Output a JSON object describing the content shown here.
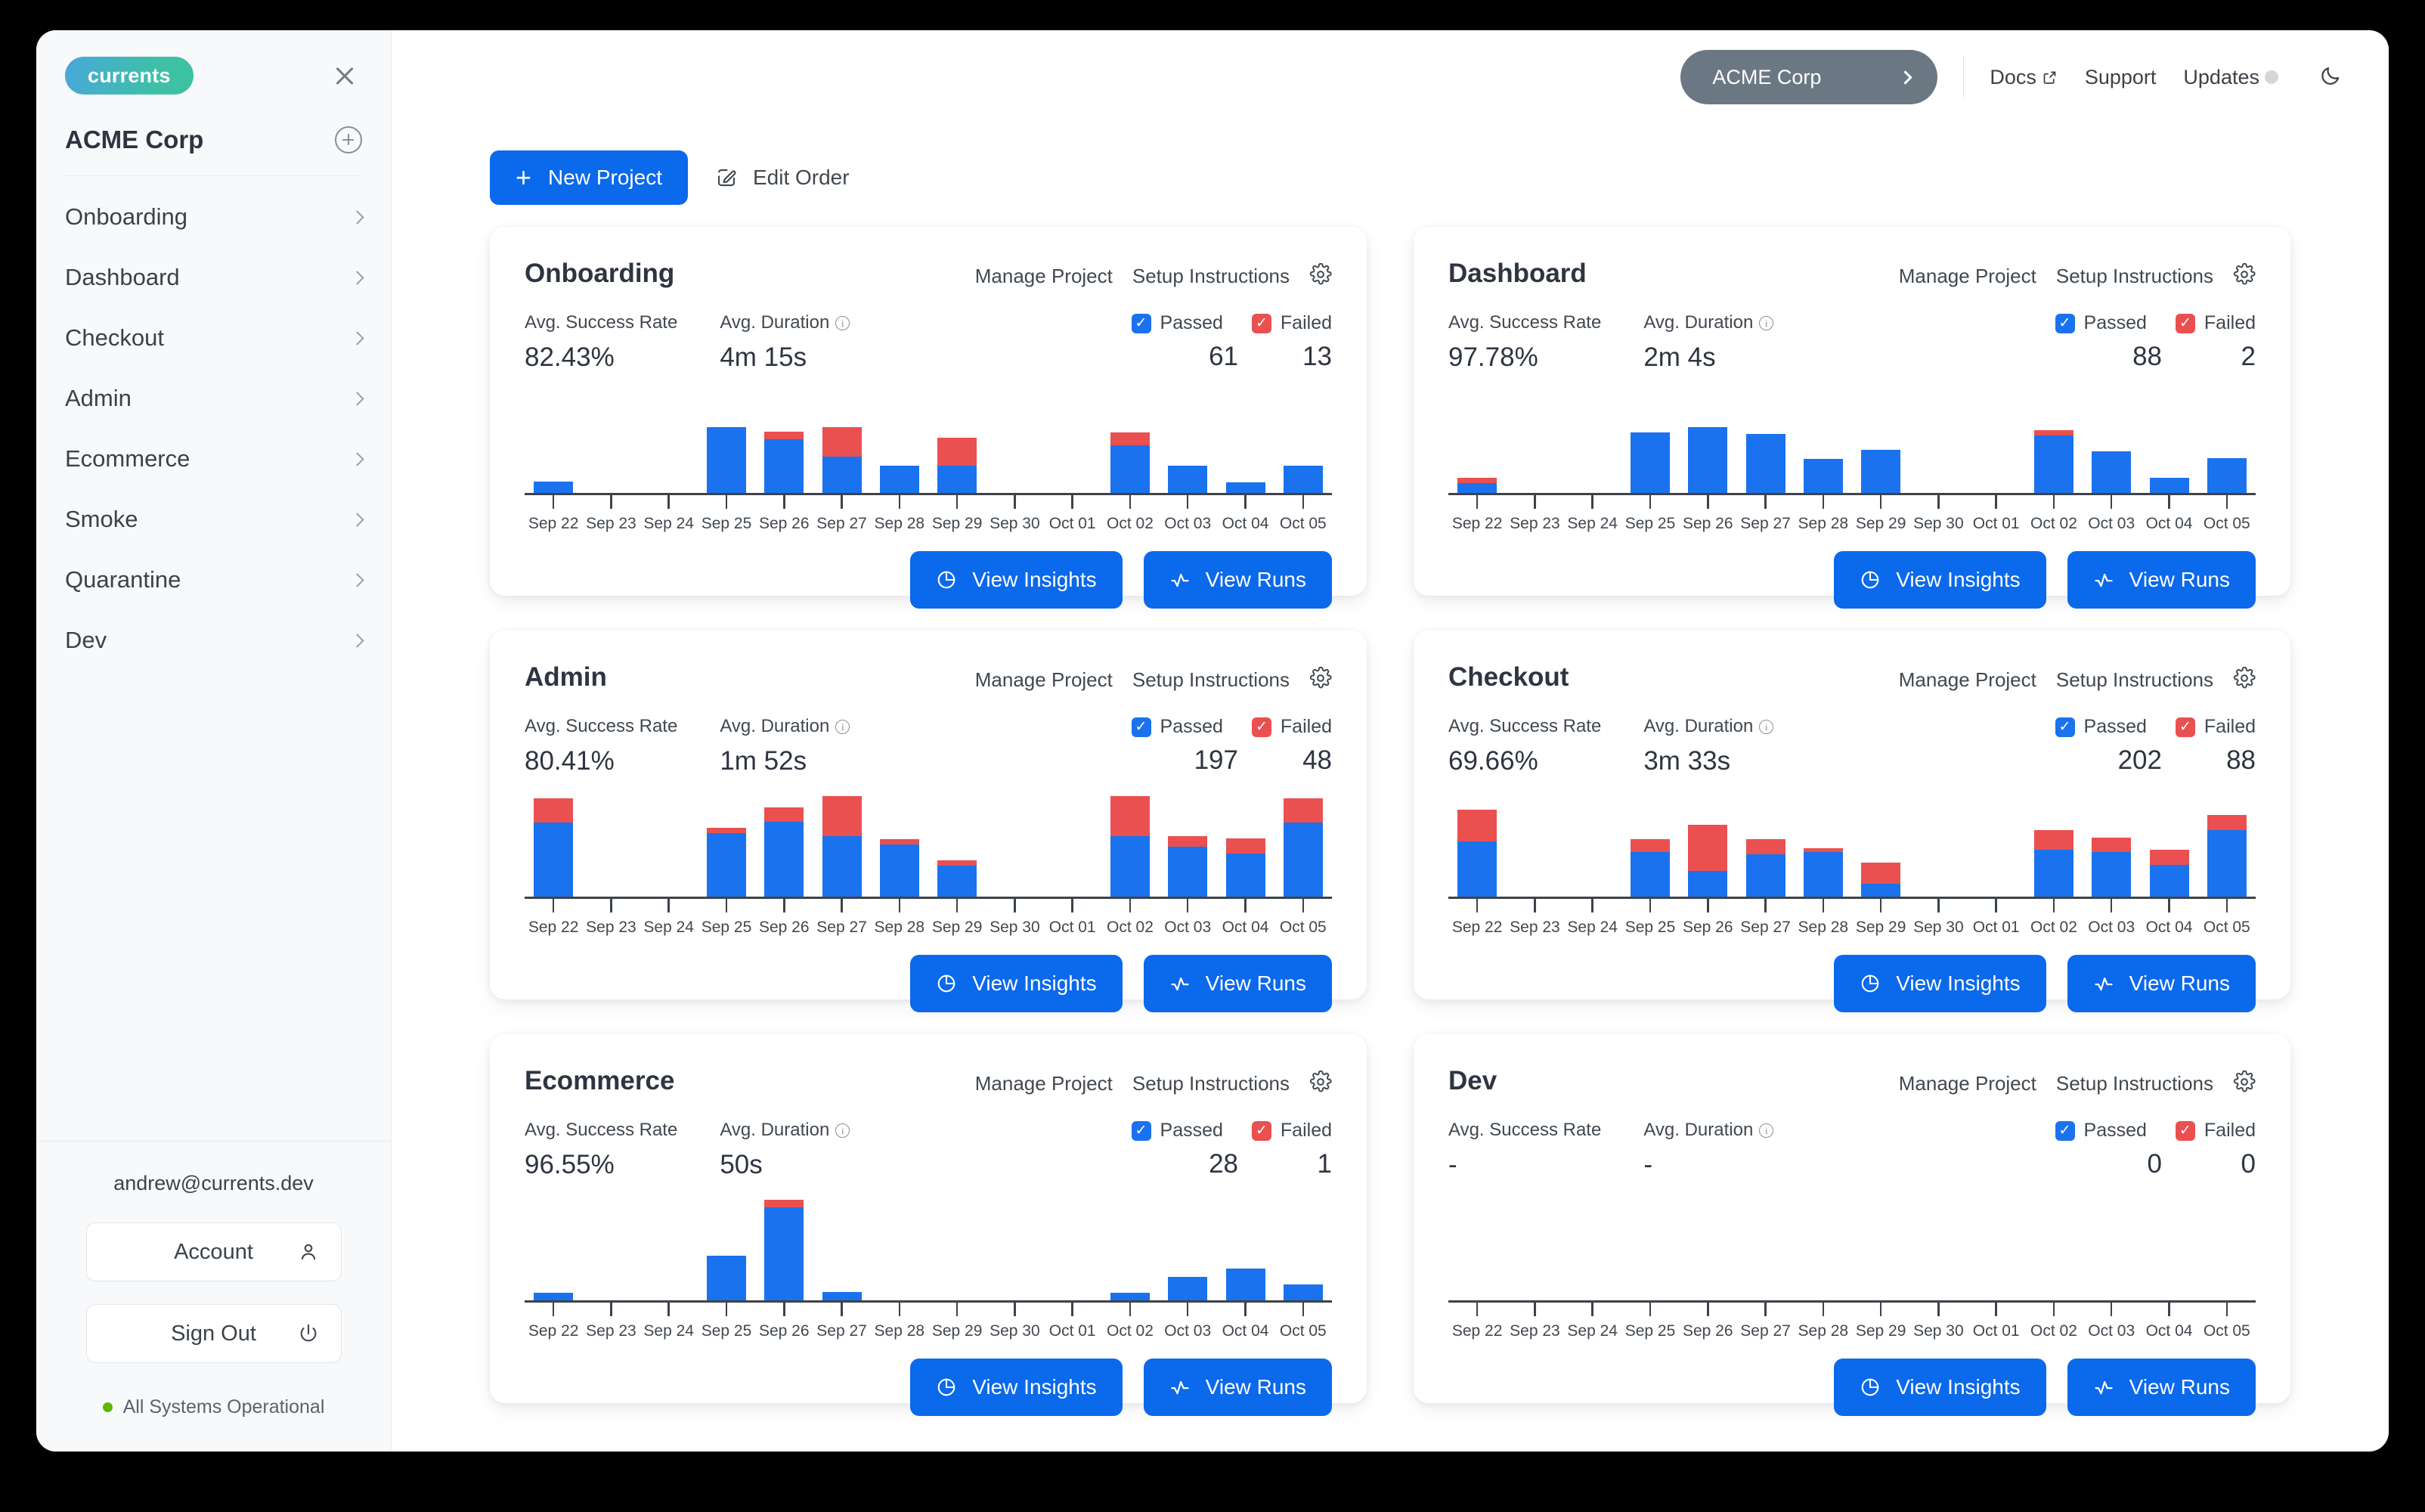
{
  "sidebar": {
    "logo": "currents",
    "close_icon": "close-icon",
    "org_name": "ACME Corp",
    "add_icon": "plus-circle-icon",
    "items": [
      {
        "label": "Onboarding"
      },
      {
        "label": "Dashboard"
      },
      {
        "label": "Checkout"
      },
      {
        "label": "Admin"
      },
      {
        "label": "Ecommerce"
      },
      {
        "label": "Smoke"
      },
      {
        "label": "Quarantine"
      },
      {
        "label": "Dev"
      }
    ],
    "email": "andrew@currents.dev",
    "account_label": "Account",
    "signout_label": "Sign Out",
    "status_text": "All Systems Operational",
    "status_color": "#5cb800"
  },
  "topbar": {
    "org_button": "ACME Corp",
    "docs": "Docs",
    "support": "Support",
    "updates": "Updates",
    "theme_icon": "moon-icon"
  },
  "toolbar": {
    "new_project": "New Project",
    "edit_order": "Edit Order"
  },
  "card_labels": {
    "manage_project": "Manage Project",
    "setup_instructions": "Setup Instructions",
    "avg_success_rate": "Avg. Success Rate",
    "avg_duration": "Avg. Duration",
    "passed": "Passed",
    "failed": "Failed",
    "view_insights": "View Insights",
    "view_runs": "View Runs"
  },
  "colors": {
    "passed": "#1b72ee",
    "failed": "#ea5050",
    "primary": "#0b69eb",
    "org_pill": "#6b7884"
  },
  "chart_data": [
    {
      "type": "bar",
      "title": "Onboarding",
      "stacked": true,
      "categories": [
        "Sep 22",
        "Sep 23",
        "Sep 24",
        "Sep 25",
        "Sep 26",
        "Sep 27",
        "Sep 28",
        "Sep 29",
        "Sep 30",
        "Oct 01",
        "Oct 02",
        "Oct 03",
        "Oct 04",
        "Oct 05"
      ],
      "series": [
        {
          "name": "Passed",
          "values": [
            11,
            0,
            0,
            62,
            51,
            34,
            26,
            26,
            0,
            0,
            45,
            26,
            10,
            26
          ]
        },
        {
          "name": "Failed",
          "values": [
            0,
            0,
            0,
            0,
            7,
            28,
            0,
            26,
            0,
            0,
            12,
            0,
            0,
            0
          ]
        }
      ],
      "ylabel": "",
      "xlabel": "",
      "grid": false,
      "legend": "top-right"
    },
    {
      "type": "bar",
      "title": "Dashboard",
      "stacked": true,
      "categories": [
        "Sep 22",
        "Sep 23",
        "Sep 24",
        "Sep 25",
        "Sep 26",
        "Sep 27",
        "Sep 28",
        "Sep 29",
        "Sep 30",
        "Oct 01",
        "Oct 02",
        "Oct 03",
        "Oct 04",
        "Oct 05"
      ],
      "series": [
        {
          "name": "Passed",
          "values": [
            9,
            0,
            0,
            57,
            62,
            56,
            32,
            41,
            0,
            0,
            54,
            39,
            14,
            33
          ]
        },
        {
          "name": "Failed",
          "values": [
            5,
            0,
            0,
            0,
            0,
            0,
            0,
            0,
            0,
            0,
            5,
            0,
            0,
            0
          ]
        }
      ],
      "ylabel": "",
      "xlabel": "",
      "grid": false,
      "legend": "top-right"
    },
    {
      "type": "bar",
      "title": "Admin",
      "stacked": true,
      "categories": [
        "Sep 22",
        "Sep 23",
        "Sep 24",
        "Sep 25",
        "Sep 26",
        "Sep 27",
        "Sep 28",
        "Sep 29",
        "Sep 30",
        "Oct 01",
        "Oct 02",
        "Oct 03",
        "Oct 04",
        "Oct 05"
      ],
      "series": [
        {
          "name": "Passed",
          "values": [
            70,
            0,
            0,
            60,
            71,
            57,
            49,
            29,
            0,
            0,
            57,
            47,
            41,
            70
          ]
        },
        {
          "name": "Failed",
          "values": [
            23,
            0,
            0,
            5,
            13,
            38,
            5,
            5,
            0,
            0,
            38,
            10,
            14,
            23
          ]
        }
      ],
      "ylabel": "",
      "xlabel": "",
      "grid": false,
      "legend": "top-right"
    },
    {
      "type": "bar",
      "title": "Checkout",
      "stacked": true,
      "categories": [
        "Sep 22",
        "Sep 23",
        "Sep 24",
        "Sep 25",
        "Sep 26",
        "Sep 27",
        "Sep 28",
        "Sep 29",
        "Sep 30",
        "Oct 01",
        "Oct 02",
        "Oct 03",
        "Oct 04",
        "Oct 05"
      ],
      "series": [
        {
          "name": "Passed",
          "values": [
            52,
            0,
            0,
            42,
            24,
            40,
            42,
            12,
            0,
            0,
            44,
            42,
            30,
            63
          ]
        },
        {
          "name": "Failed",
          "values": [
            30,
            0,
            0,
            12,
            44,
            14,
            4,
            20,
            0,
            0,
            19,
            14,
            14,
            14
          ]
        }
      ],
      "ylabel": "",
      "xlabel": "",
      "grid": false,
      "legend": "top-right"
    },
    {
      "type": "bar",
      "title": "Ecommerce",
      "stacked": true,
      "categories": [
        "Sep 22",
        "Sep 23",
        "Sep 24",
        "Sep 25",
        "Sep 26",
        "Sep 27",
        "Sep 28",
        "Sep 29",
        "Sep 30",
        "Oct 01",
        "Oct 02",
        "Oct 03",
        "Oct 04",
        "Oct 05"
      ],
      "series": [
        {
          "name": "Passed",
          "values": [
            7,
            0,
            0,
            42,
            88,
            8,
            0,
            0,
            0,
            0,
            7,
            22,
            30,
            15
          ]
        },
        {
          "name": "Failed",
          "values": [
            0,
            0,
            0,
            0,
            7,
            0,
            0,
            0,
            0,
            0,
            0,
            0,
            0,
            0
          ]
        }
      ],
      "ylabel": "",
      "xlabel": "",
      "grid": false,
      "legend": "top-right"
    },
    {
      "type": "bar",
      "title": "Dev",
      "stacked": true,
      "categories": [
        "Sep 22",
        "Sep 23",
        "Sep 24",
        "Sep 25",
        "Sep 26",
        "Sep 27",
        "Sep 28",
        "Sep 29",
        "Sep 30",
        "Oct 01",
        "Oct 02",
        "Oct 03",
        "Oct 04",
        "Oct 05"
      ],
      "series": [
        {
          "name": "Passed",
          "values": [
            0,
            0,
            0,
            0,
            0,
            0,
            0,
            0,
            0,
            0,
            0,
            0,
            0,
            0
          ]
        },
        {
          "name": "Failed",
          "values": [
            0,
            0,
            0,
            0,
            0,
            0,
            0,
            0,
            0,
            0,
            0,
            0,
            0,
            0
          ]
        }
      ],
      "ylabel": "",
      "xlabel": "",
      "grid": false,
      "legend": "top-right"
    }
  ],
  "cards": [
    {
      "title": "Onboarding",
      "success_rate": "82.43%",
      "duration": "4m 15s",
      "passed": "61",
      "failed": "13"
    },
    {
      "title": "Dashboard",
      "success_rate": "97.78%",
      "duration": "2m 4s",
      "passed": "88",
      "failed": "2"
    },
    {
      "title": "Admin",
      "success_rate": "80.41%",
      "duration": "1m 52s",
      "passed": "197",
      "failed": "48"
    },
    {
      "title": "Checkout",
      "success_rate": "69.66%",
      "duration": "3m 33s",
      "passed": "202",
      "failed": "88"
    },
    {
      "title": "Ecommerce",
      "success_rate": "96.55%",
      "duration": "50s",
      "passed": "28",
      "failed": "1"
    },
    {
      "title": "Dev",
      "success_rate": "-",
      "duration": "-",
      "passed": "0",
      "failed": "0"
    }
  ]
}
